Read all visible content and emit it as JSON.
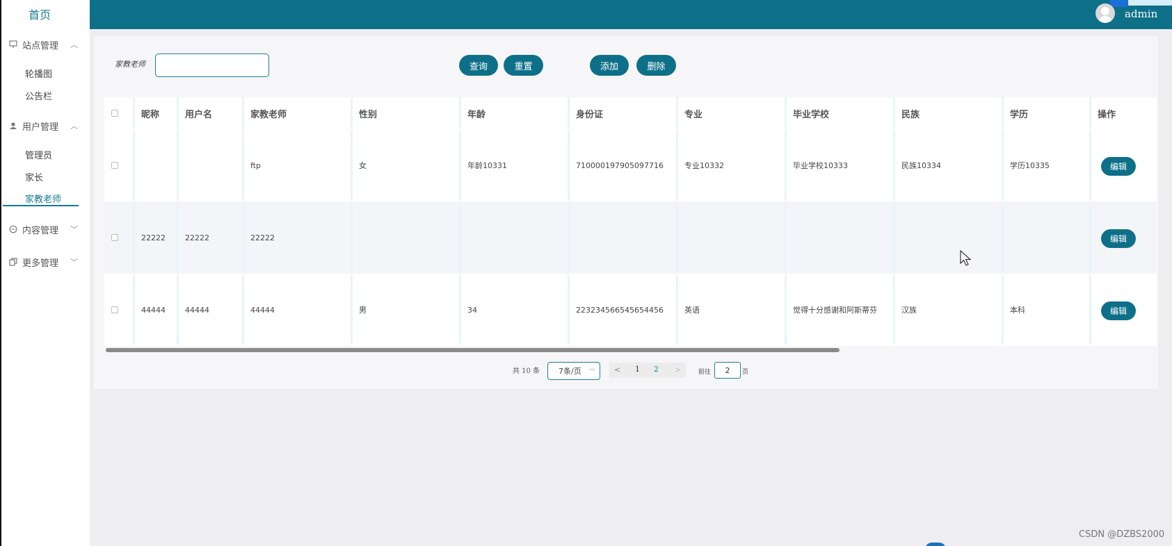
{
  "sidebar": {
    "home": "首页",
    "groups": [
      {
        "icon": "monitor-icon",
        "label": "站点管理",
        "items": [
          "轮播图",
          "公告栏"
        ]
      },
      {
        "icon": "user-icon",
        "label": "用户管理",
        "items": [
          "管理员",
          "家长",
          "家教老师"
        ]
      },
      {
        "icon": "chat-icon",
        "label": "内容管理",
        "items": []
      },
      {
        "icon": "copy-icon",
        "label": "更多管理",
        "items": []
      }
    ],
    "active_item": "家教老师"
  },
  "header": {
    "username": "admin"
  },
  "search": {
    "label": "家教老师",
    "value": ""
  },
  "buttons": {
    "query": "查询",
    "reset": "重置",
    "add": "添加",
    "delete": "删除"
  },
  "table": {
    "columns": [
      "昵称",
      "用户名",
      "家教老师",
      "性别",
      "年龄",
      "身份证",
      "专业",
      "毕业学校",
      "民族",
      "学历",
      "操作"
    ],
    "rows": [
      {
        "nick": "",
        "username": "",
        "teacher": "ftp",
        "gender": "女",
        "age": "年龄10331",
        "idcard": "710000197905097716",
        "major": "专业10332",
        "school": "毕业学校10333",
        "ethnic": "民族10334",
        "edu": "学历10335",
        "action": "编辑"
      },
      {
        "nick": "22222",
        "username": "22222",
        "teacher": "22222",
        "gender": "",
        "age": "",
        "idcard": "",
        "major": "",
        "school": "",
        "ethnic": "",
        "edu": "",
        "action": "编辑"
      },
      {
        "nick": "44444",
        "username": "44444",
        "teacher": "44444",
        "gender": "男",
        "age": "34",
        "idcard": "223234566545654456",
        "major": "英语",
        "school": "觉得十分感谢和阿斯蒂芬",
        "ethnic": "汉族",
        "edu": "本科",
        "action": "编辑"
      }
    ]
  },
  "pagination": {
    "total": "共 10 条",
    "page_size": "7条/页",
    "pages": [
      "1",
      "2"
    ],
    "current_page": "2",
    "goto_label": "前往",
    "goto_value": "2",
    "page_suffix": "页"
  },
  "watermark": "CSDN @DZBS2000",
  "colors": {
    "primary": "#0e7088",
    "accent": "#147a92",
    "header": "#0e7088"
  }
}
